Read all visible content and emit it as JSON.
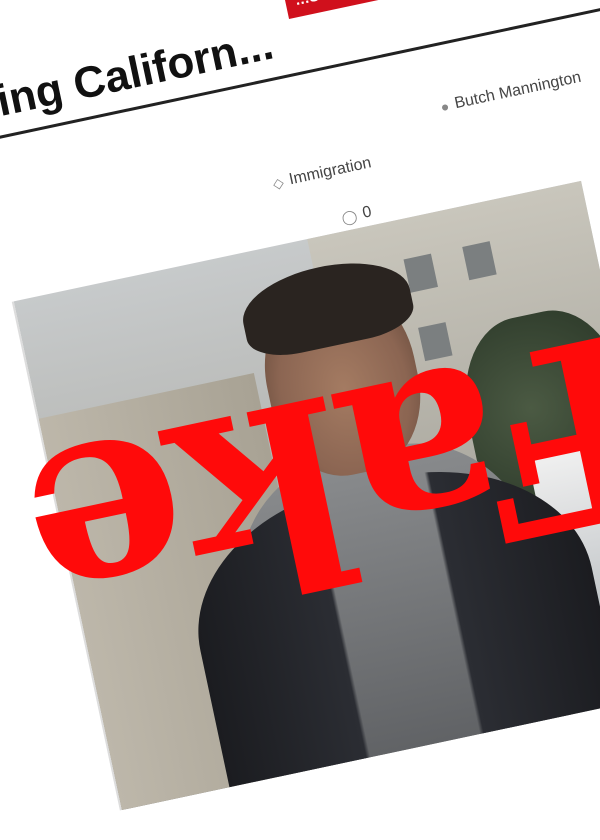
{
  "article": {
    "headline_line1": "",
    "headline_line2": "...tarting Californ...",
    "badge": "...S ANIMAL UP!",
    "author": "Butch Mannington",
    "category": "Immigration",
    "comments": "0"
  },
  "overlay": {
    "stamp_text": "Fake",
    "stamp_color": "#ff0a0a"
  },
  "icons": {
    "author": "user-icon",
    "category": "tag-icon",
    "comments": "comment-icon"
  },
  "colors": {
    "badge_bg": "#d0101c",
    "text": "#111111"
  }
}
